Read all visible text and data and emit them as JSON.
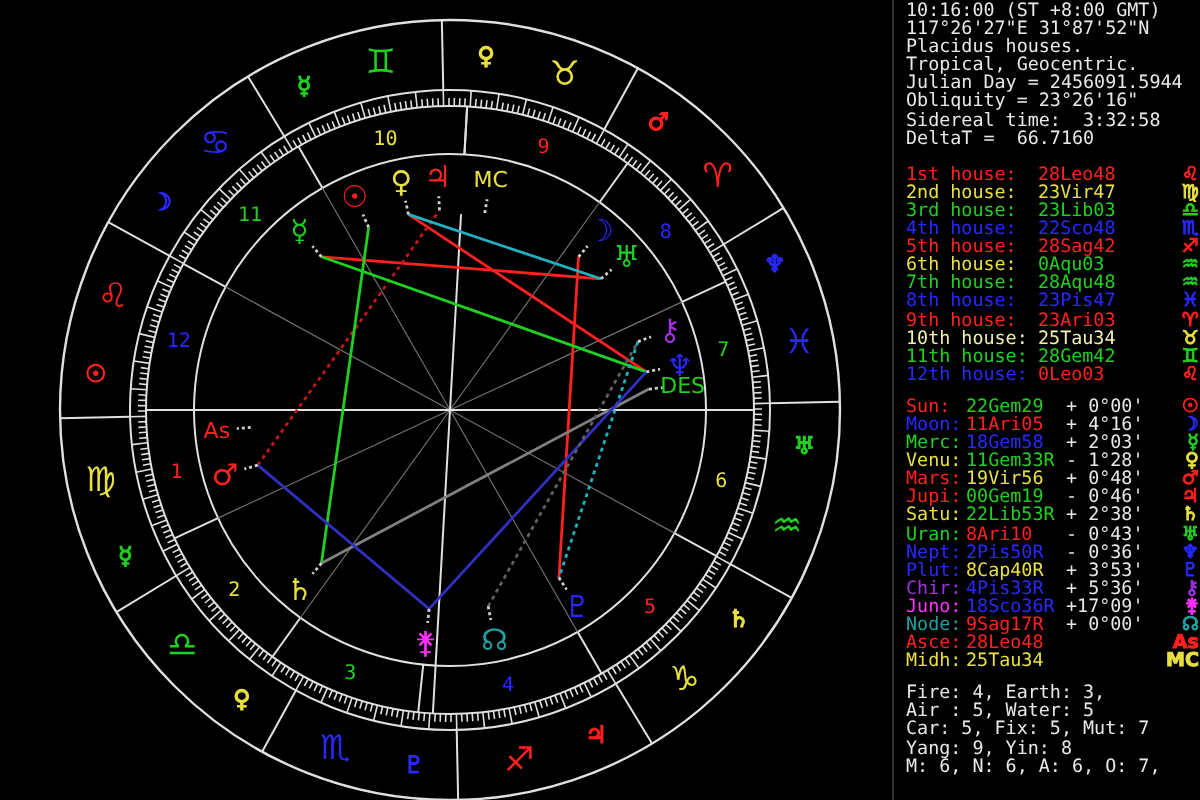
{
  "header_lines": [
    "10:16:00 (ST +8:00 GMT)",
    "117°26'27\"E 31°87'52\"N",
    "Placidus houses.",
    "Tropical, Geocentric.",
    "Julian Day = 2456091.5944",
    "Obliquity = 23°26'16\"",
    "Sidereal time:  3:32:58",
    "DeltaT =  66.7160"
  ],
  "houses": [
    {
      "label": {
        "text": "1st house:",
        "color": "#ff2020"
      },
      "position": {
        "text": "28Leo48",
        "color": "#ff2020"
      },
      "glyph": {
        "text": "♌",
        "color": "#ff2020"
      }
    },
    {
      "label": {
        "text": "2nd house:",
        "color": "#e8e040"
      },
      "position": {
        "text": "23Vir47",
        "color": "#e8e040"
      },
      "glyph": {
        "text": "♍",
        "color": "#e8e040"
      }
    },
    {
      "label": {
        "text": "3rd house:",
        "color": "#20d020"
      },
      "position": {
        "text": "23Lib03",
        "color": "#20d020"
      },
      "glyph": {
        "text": "♎",
        "color": "#20d020"
      }
    },
    {
      "label": {
        "text": "4th house:",
        "color": "#2828ff"
      },
      "position": {
        "text": "22Sco48",
        "color": "#2828ff"
      },
      "glyph": {
        "text": "♏",
        "color": "#2828ff"
      }
    },
    {
      "label": {
        "text": "5th house:",
        "color": "#ff2020"
      },
      "position": {
        "text": "28Sag42",
        "color": "#ff2020"
      },
      "glyph": {
        "text": "♐",
        "color": "#ff2020"
      }
    },
    {
      "label": {
        "text": "6th house:",
        "color": "#e8e040"
      },
      "position": {
        "text": "0Aqu03",
        "color": "#20d020"
      },
      "glyph": {
        "text": "♒",
        "color": "#20d020"
      }
    },
    {
      "label": {
        "text": "7th house:",
        "color": "#20d020"
      },
      "position": {
        "text": "28Aqu48",
        "color": "#20d020"
      },
      "glyph": {
        "text": "♒",
        "color": "#20d020"
      }
    },
    {
      "label": {
        "text": "8th house:",
        "color": "#2828ff"
      },
      "position": {
        "text": "23Pis47",
        "color": "#2828ff"
      },
      "glyph": {
        "text": "♓",
        "color": "#2828ff"
      }
    },
    {
      "label": {
        "text": "9th house:",
        "color": "#ff2020"
      },
      "position": {
        "text": "23Ari03",
        "color": "#ff2020"
      },
      "glyph": {
        "text": "♈",
        "color": "#ff2020"
      }
    },
    {
      "label": {
        "text": "10th house:",
        "color": "#f0f0b0"
      },
      "position": {
        "text": "25Tau34",
        "color": "#f0f0b0"
      },
      "glyph": {
        "text": "♉",
        "color": "#e8e040"
      }
    },
    {
      "label": {
        "text": "11th house:",
        "color": "#20d020"
      },
      "position": {
        "text": "28Gem42",
        "color": "#20d020"
      },
      "glyph": {
        "text": "♊",
        "color": "#20d020"
      }
    },
    {
      "label": {
        "text": "12th house:",
        "color": "#2828ff"
      },
      "position": {
        "text": "0Leo03",
        "color": "#ff2020"
      },
      "glyph": {
        "text": "♌",
        "color": "#ff2020"
      }
    }
  ],
  "planets": [
    {
      "label": {
        "text": "Sun:",
        "color": "#ff2020"
      },
      "position": {
        "text": "22Gem29",
        "color": "#20d020"
      },
      "offset": "+ 0°00'",
      "glyph": {
        "text": "☉",
        "color": "#ff2020"
      }
    },
    {
      "label": {
        "text": "Moon:",
        "color": "#2828ff"
      },
      "position": {
        "text": "11Ari05",
        "color": "#ff2020"
      },
      "offset": "+ 4°16'",
      "glyph": {
        "text": "☽",
        "color": "#2828ff"
      }
    },
    {
      "label": {
        "text": "Merc:",
        "color": "#20d020"
      },
      "position": {
        "text": "18Gem58",
        "color": "#2828ff"
      },
      "offset": "+ 2°03'",
      "glyph": {
        "text": "☿",
        "color": "#20d020"
      }
    },
    {
      "label": {
        "text": "Venu:",
        "color": "#e8e040"
      },
      "position": {
        "text": "11Gem33R",
        "color": "#20d020"
      },
      "offset": "- 1°28'",
      "glyph": {
        "text": "♀",
        "color": "#e8e040"
      }
    },
    {
      "label": {
        "text": "Mars:",
        "color": "#ff2020"
      },
      "position": {
        "text": "19Vir56",
        "color": "#e8e040"
      },
      "offset": "+ 0°48'",
      "glyph": {
        "text": "♂",
        "color": "#ff2020"
      }
    },
    {
      "label": {
        "text": "Jupi:",
        "color": "#ff2020"
      },
      "position": {
        "text": "00Gem19",
        "color": "#20d020"
      },
      "offset": "- 0°46'",
      "glyph": {
        "text": "♃",
        "color": "#ff2020"
      }
    },
    {
      "label": {
        "text": "Satu:",
        "color": "#e8e040"
      },
      "position": {
        "text": "22Lib53R",
        "color": "#20d020"
      },
      "offset": "+ 2°38'",
      "glyph": {
        "text": "♄",
        "color": "#e8e040"
      }
    },
    {
      "label": {
        "text": "Uran:",
        "color": "#20d020"
      },
      "position": {
        "text": "8Ari10",
        "color": "#ff2020"
      },
      "offset": "- 0°43'",
      "glyph": {
        "text": "♅",
        "color": "#20d020"
      }
    },
    {
      "label": {
        "text": "Nept:",
        "color": "#2828ff"
      },
      "position": {
        "text": "2Pis50R",
        "color": "#2828ff"
      },
      "offset": "- 0°36'",
      "glyph": {
        "text": "♆",
        "color": "#2828ff"
      }
    },
    {
      "label": {
        "text": "Plut:",
        "color": "#2828ff"
      },
      "position": {
        "text": "8Cap40R",
        "color": "#e8e040"
      },
      "offset": "+ 3°53'",
      "glyph": {
        "text": "♇",
        "color": "#2828ff"
      }
    },
    {
      "label": {
        "text": "Chir:",
        "color": "#a030e0"
      },
      "position": {
        "text": "4Pis33R",
        "color": "#2828ff"
      },
      "offset": "+ 5°36'",
      "glyph": {
        "text": "⚷",
        "color": "#a030e0"
      }
    },
    {
      "label": {
        "text": "Juno:",
        "color": "#ff30ff"
      },
      "position": {
        "text": "18Sco36R",
        "color": "#2828ff"
      },
      "offset": "+17°09'",
      "glyph": {
        "text": "⚵",
        "color": "#ff30ff"
      }
    },
    {
      "label": {
        "text": "Node:",
        "color": "#20a0a0"
      },
      "position": {
        "text": "9Sag17R",
        "color": "#ff2020"
      },
      "offset": "+ 0°00'",
      "glyph": {
        "text": "☊",
        "color": "#20a0a0"
      }
    },
    {
      "label": {
        "text": "Asce:",
        "color": "#ff2020"
      },
      "position": {
        "text": "28Leo48",
        "color": "#ff2020"
      },
      "glyph": {
        "text": "As",
        "color": "#ff2020"
      }
    },
    {
      "label": {
        "text": "Midh:",
        "color": "#e8e040"
      },
      "position": {
        "text": "25Tau34",
        "color": "#e8e040"
      },
      "glyph": {
        "text": "MC",
        "color": "#e8e040"
      }
    }
  ],
  "stats_lines": [
    "Fire: 4, Earth: 3,",
    "Air : 5, Water: 5",
    "Car: 5, Fix: 5, Mut: 7",
    "Yang: 9, Yin: 8",
    "M: 6, N: 6, A: 6, O: 7,"
  ],
  "wheel": {
    "signs": [
      {
        "glyph": {
          "text": "♊",
          "color": "#20d020"
        },
        "ruler": {
          "text": "☿",
          "color": "#20d020"
        }
      },
      {
        "glyph": {
          "text": "♉",
          "color": "#e8e040"
        },
        "ruler": {
          "text": "♀",
          "color": "#e8e040"
        }
      },
      {
        "glyph": {
          "text": "♋",
          "color": "#2828ff"
        },
        "ruler": {
          "text": "☽",
          "color": "#2828ff"
        }
      },
      {
        "glyph": {
          "text": "♈",
          "color": "#ff2020"
        },
        "ruler": {
          "text": "♂",
          "color": "#ff2020"
        }
      },
      {
        "glyph": {
          "text": "♌",
          "color": "#ff2020"
        },
        "ruler": {
          "text": "☉",
          "color": "#ff2020"
        }
      },
      {
        "glyph": {
          "text": "♓",
          "color": "#2828ff"
        },
        "ruler": {
          "text": "♆",
          "color": "#2828ff"
        }
      },
      {
        "glyph": {
          "text": "♍",
          "color": "#e8e040"
        },
        "ruler": {
          "text": "☿",
          "color": "#20d020"
        }
      },
      {
        "glyph": {
          "text": "♒",
          "color": "#20d020"
        },
        "ruler": {
          "text": "♅",
          "color": "#20d020"
        }
      },
      {
        "glyph": {
          "text": "♎",
          "color": "#20d020"
        },
        "ruler": {
          "text": "♀",
          "color": "#e8e040"
        }
      },
      {
        "glyph": {
          "text": "♑",
          "color": "#e8e040"
        },
        "ruler": {
          "text": "♄",
          "color": "#e8e040"
        }
      },
      {
        "glyph": {
          "text": "♏",
          "color": "#2828ff"
        },
        "ruler": {
          "text": "♇",
          "color": "#2828ff"
        }
      },
      {
        "glyph": {
          "text": "♐",
          "color": "#ff2020"
        },
        "ruler": {
          "text": "♃",
          "color": "#ff2020"
        }
      }
    ],
    "house_numbers": [
      {
        "text": "10",
        "color": "#e8e040"
      },
      {
        "text": "9",
        "color": "#ff2020"
      },
      {
        "text": "8",
        "color": "#2828ff"
      },
      {
        "text": "7",
        "color": "#20d020"
      },
      {
        "text": "6",
        "color": "#e8e040"
      },
      {
        "text": "5",
        "color": "#ff2020"
      },
      {
        "text": "4",
        "color": "#2828ff"
      },
      {
        "text": "3",
        "color": "#20d020"
      },
      {
        "text": "2",
        "color": "#e8e040"
      },
      {
        "text": "1",
        "color": "#ff2020"
      },
      {
        "text": "12",
        "color": "#2828ff"
      },
      {
        "text": "11",
        "color": "#20d020"
      }
    ],
    "points": [
      {
        "text": "☿",
        "color": "#20d020"
      },
      {
        "text": "☉",
        "color": "#ff2020"
      },
      {
        "text": "♀",
        "color": "#e8e040"
      },
      {
        "text": "♃",
        "color": "#ff2020"
      },
      {
        "text": "MC",
        "color": "#e8e040"
      },
      {
        "text": "☽",
        "color": "#2828ff"
      },
      {
        "text": "♅",
        "color": "#20d020"
      },
      {
        "text": "⚷",
        "color": "#a030e0"
      },
      {
        "text": "♆",
        "color": "#2828ff"
      },
      {
        "text": "DES",
        "color": "#20d020"
      },
      {
        "text": "♇",
        "color": "#2828ff"
      },
      {
        "text": "☊",
        "color": "#20a0a0"
      },
      {
        "text": "⚵",
        "color": "#ff30ff"
      },
      {
        "text": "♄",
        "color": "#e8e040"
      },
      {
        "text": "♂",
        "color": "#ff2020"
      },
      {
        "text": "As",
        "color": "#ff2020"
      }
    ]
  }
}
